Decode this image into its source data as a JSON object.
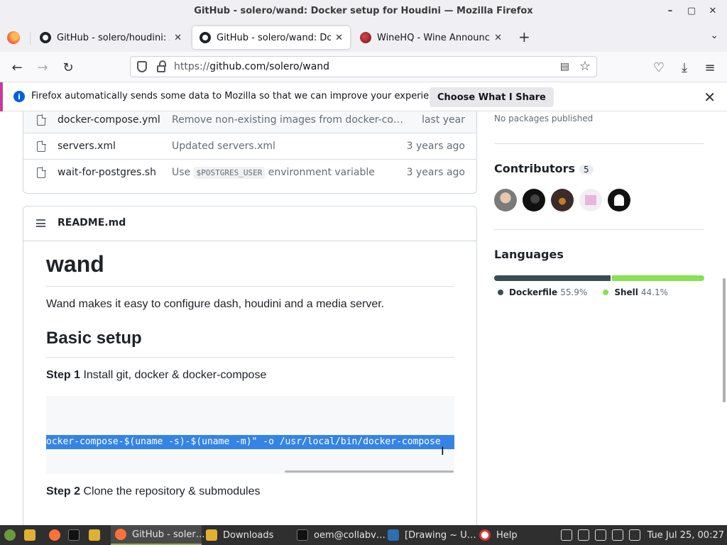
{
  "window": {
    "title": "GitHub - solero/wand: Docker setup for Houdini — Mozilla Firefox",
    "minimize": "–",
    "maximize": "▢",
    "close": "✕"
  },
  "tabs": [
    {
      "label": "GitHub - solero/houdini: A C",
      "close": "✕"
    },
    {
      "label": "GitHub - solero/wand: Dock",
      "close": "✕"
    },
    {
      "label": "WineHQ - Wine Announcem",
      "close": "✕"
    }
  ],
  "toolbar": {
    "new_tab": "+",
    "list_tabs": "⌄",
    "back": "←",
    "forward": "→",
    "reload": "↻",
    "url_prefix": "https://",
    "url_main": "github.com/solero/wand",
    "reader": "▤",
    "bookmark": "☆",
    "pocket": "♡",
    "downloads": "⤓",
    "menu": "≡"
  },
  "notification": {
    "info": "i",
    "message": "Firefox automatically sends some data to Mozilla so that we can improve your experience.",
    "button": "Choose What I Share",
    "close": "✕"
  },
  "files": [
    {
      "name": "docker-compose.yml",
      "message": "Remove non-existing images from docker-co…",
      "date": "last year"
    },
    {
      "name": "servers.xml",
      "message": "Updated servers.xml",
      "date": "3 years ago"
    },
    {
      "name": "wait-for-postgres.sh",
      "message_before": "Use",
      "message_code": "$POSTGRES_USER",
      "message_after": "environment variable",
      "date": "3 years ago"
    }
  ],
  "readme": {
    "filename": "README.md",
    "h1": "wand",
    "intro": "Wand makes it easy to configure dash, houdini and a media server.",
    "h2": "Basic setup",
    "step1_label": "Step 1",
    "step1_text": " Install git, docker & docker-compose",
    "code_selected": "ocker-compose-$(uname -s)-$(uname -m)\" -o /usr/local/bin/docker-compose",
    "cursor": "I",
    "step2_label": "Step 2",
    "step2_text": " Clone the repository & submodules"
  },
  "sidebar": {
    "packages": "No packages published",
    "contributors_title": "Contributors",
    "contributors_count": "5",
    "languages_title": "Languages",
    "languages": [
      {
        "name": "Dockerfile",
        "percent": "55.9%",
        "value": 55.9,
        "color": "#384d54"
      },
      {
        "name": "Shell",
        "percent": "44.1%",
        "value": 44.1,
        "color": "#89e051"
      }
    ]
  },
  "taskbar": {
    "items": [
      {
        "label": "GitHub - soler…",
        "icon": "firefox-icon"
      },
      {
        "label": "Downloads",
        "icon": "folder-icon"
      },
      {
        "label": "oem@collabv…",
        "icon": "terminal-icon"
      },
      {
        "label": "[Drawing ~ U…",
        "icon": "drawing-icon"
      },
      {
        "label": "Help",
        "icon": "help-icon"
      }
    ],
    "clock": "Tue Jul 25, 00:27"
  }
}
